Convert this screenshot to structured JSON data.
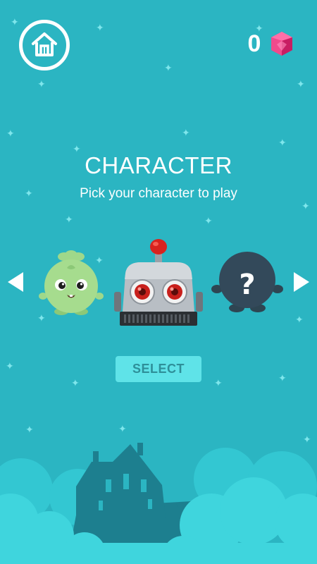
{
  "header": {
    "home_icon": "home-icon",
    "gem_count": "0",
    "gem_icon": "pink-gem-icon",
    "gem_color": "#e8317a"
  },
  "title": "CHARACTER",
  "subtitle": "Pick your character to play",
  "carousel": {
    "prev_icon": "left-arrow-icon",
    "next_icon": "right-arrow-icon",
    "characters": [
      {
        "name": "green-blob-character",
        "locked": false
      },
      {
        "name": "robot-character",
        "locked": false,
        "selected": true
      },
      {
        "name": "locked-character",
        "locked": true,
        "mark": "?"
      }
    ]
  },
  "select_label": "SELECT",
  "colors": {
    "background": "#2bb5c2",
    "accent": "#5fe3e8",
    "clouds": "#3fd5dd",
    "silhouette": "#1d7f8f"
  }
}
